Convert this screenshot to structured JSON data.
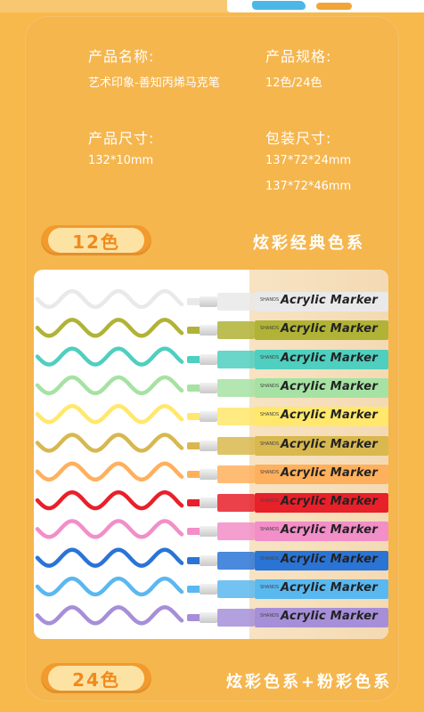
{
  "specs": {
    "name_label": "产品名称:",
    "name_value": "艺术印象-善知丙烯马克笔",
    "spec_label": "产品规格:",
    "spec_value": "12色/24色",
    "size_label": "产品尺寸:",
    "size_value": "132*10mm",
    "package_label": "包装尺寸:",
    "package_value_1": "137*72*24mm",
    "package_value_2": "137*72*46mm"
  },
  "sections": [
    {
      "badge": "12色",
      "title": "炫彩经典色系"
    },
    {
      "badge": "24色",
      "title": "炫彩色系+粉彩色系"
    }
  ],
  "markers": {
    "brand": "SHANDS",
    "label": "Acrylic Marker",
    "colors": [
      "#e9e9e9",
      "#b0b336",
      "#4fcfbf",
      "#a6e2a3",
      "#ffe86b",
      "#d8b84f",
      "#ffb05c",
      "#e8202a",
      "#f28ec8",
      "#2a74d6",
      "#5ab8f0",
      "#a68fd8"
    ]
  },
  "colors": {
    "background": "#f8b94c",
    "accent": "#f29a2e",
    "badge_fill": "#fde3a3"
  }
}
